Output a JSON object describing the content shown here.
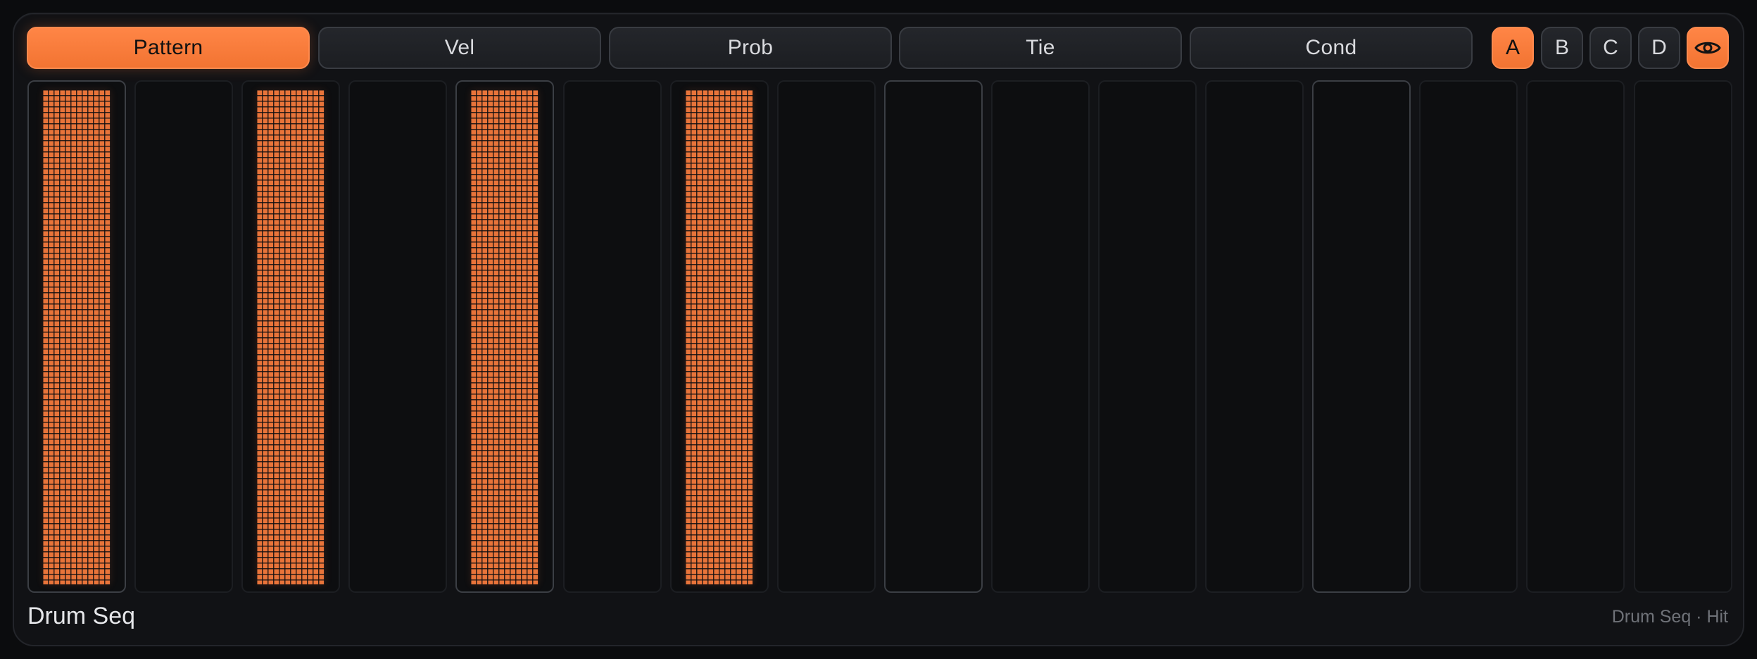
{
  "tabs": [
    {
      "label": "Pattern",
      "active": true
    },
    {
      "label": "Vel",
      "active": false
    },
    {
      "label": "Prob",
      "active": false
    },
    {
      "label": "Tie",
      "active": false
    },
    {
      "label": "Cond",
      "active": false
    }
  ],
  "banks": [
    {
      "label": "A",
      "active": true
    },
    {
      "label": "B",
      "active": false
    },
    {
      "label": "C",
      "active": false
    },
    {
      "label": "D",
      "active": false
    }
  ],
  "view_toggle": {
    "icon": "eye-icon",
    "active": true
  },
  "steps": [
    {
      "active": true,
      "level": 1.0
    },
    {
      "active": false,
      "level": 0
    },
    {
      "active": true,
      "level": 1.0
    },
    {
      "active": false,
      "level": 0
    },
    {
      "active": true,
      "level": 1.0
    },
    {
      "active": false,
      "level": 0
    },
    {
      "active": true,
      "level": 1.0
    },
    {
      "active": false,
      "level": 0
    },
    {
      "active": false,
      "level": 0
    },
    {
      "active": false,
      "level": 0
    },
    {
      "active": false,
      "level": 0
    },
    {
      "active": false,
      "level": 0
    },
    {
      "active": false,
      "level": 0
    },
    {
      "active": false,
      "level": 0
    },
    {
      "active": false,
      "level": 0
    },
    {
      "active": false,
      "level": 0
    }
  ],
  "footer": {
    "title": "Drum Seq",
    "subtitle": "Drum Seq · Hit"
  },
  "colors": {
    "accent": "#f27432",
    "background": "#111215"
  }
}
